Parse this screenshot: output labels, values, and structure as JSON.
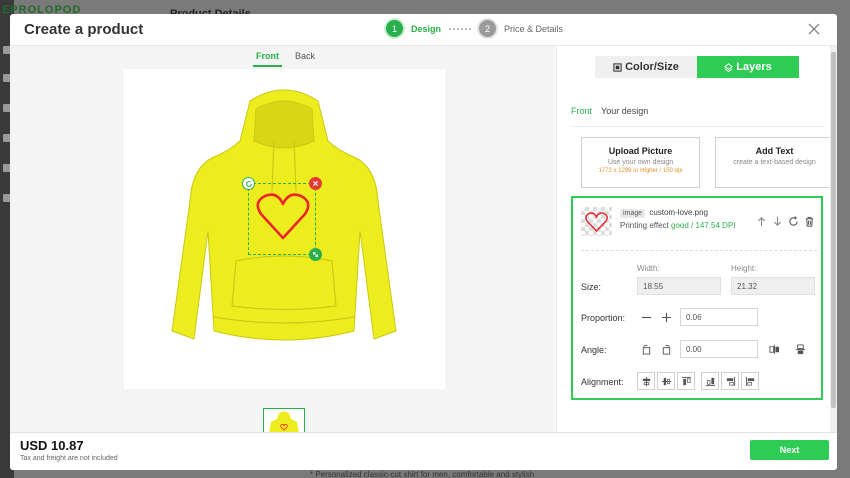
{
  "background": {
    "logo": "EPROLOPOD",
    "page_title": "Product Details",
    "footnote": "* Personalized classic-cut shirt for men, comfortable and stylish"
  },
  "modal": {
    "title": "Create a product",
    "steps": [
      {
        "number": "1",
        "label": "Design",
        "state": "active"
      },
      {
        "number": "2",
        "label": "Price & Details",
        "state": "inactive"
      }
    ]
  },
  "view_tabs": {
    "front": "Front",
    "back": "Back",
    "selected": "Front"
  },
  "product": {
    "color": "#eded1d",
    "design_icon": "heart-icon",
    "design_color": "#e8262c"
  },
  "panel": {
    "mode_tabs": {
      "color_size": "Color/Size",
      "layers": "Layers",
      "selected": "Layers"
    },
    "sub_tabs": {
      "front": "Front",
      "your_design": "Your design"
    },
    "upload": {
      "title": "Upload Picture",
      "subtitle": "Use your own design",
      "hint": "1772 x 1299 or Higher / 150 dpi"
    },
    "add_text": {
      "title": "Add Text",
      "subtitle": "create a text-based design"
    },
    "layer": {
      "type": "image",
      "name": "custom-love.png",
      "effect_prefix": "Printing effect",
      "effect_value": "good / 147.54 DPI"
    },
    "size": {
      "label": "Size:",
      "width_caption": "Width:",
      "height_caption": "Height:",
      "width": "18.55",
      "height": "21.32"
    },
    "proportion": {
      "label": "Proportion:",
      "value": "0.06"
    },
    "angle": {
      "label": "Angle:",
      "value": "0.00"
    },
    "alignment": {
      "label": "Alignment:"
    }
  },
  "footer": {
    "price": "USD 10.87",
    "note": "Tax and freight are not included",
    "next_label": "Next"
  },
  "colors": {
    "accent": "#2ecc55",
    "danger": "#e53935"
  }
}
